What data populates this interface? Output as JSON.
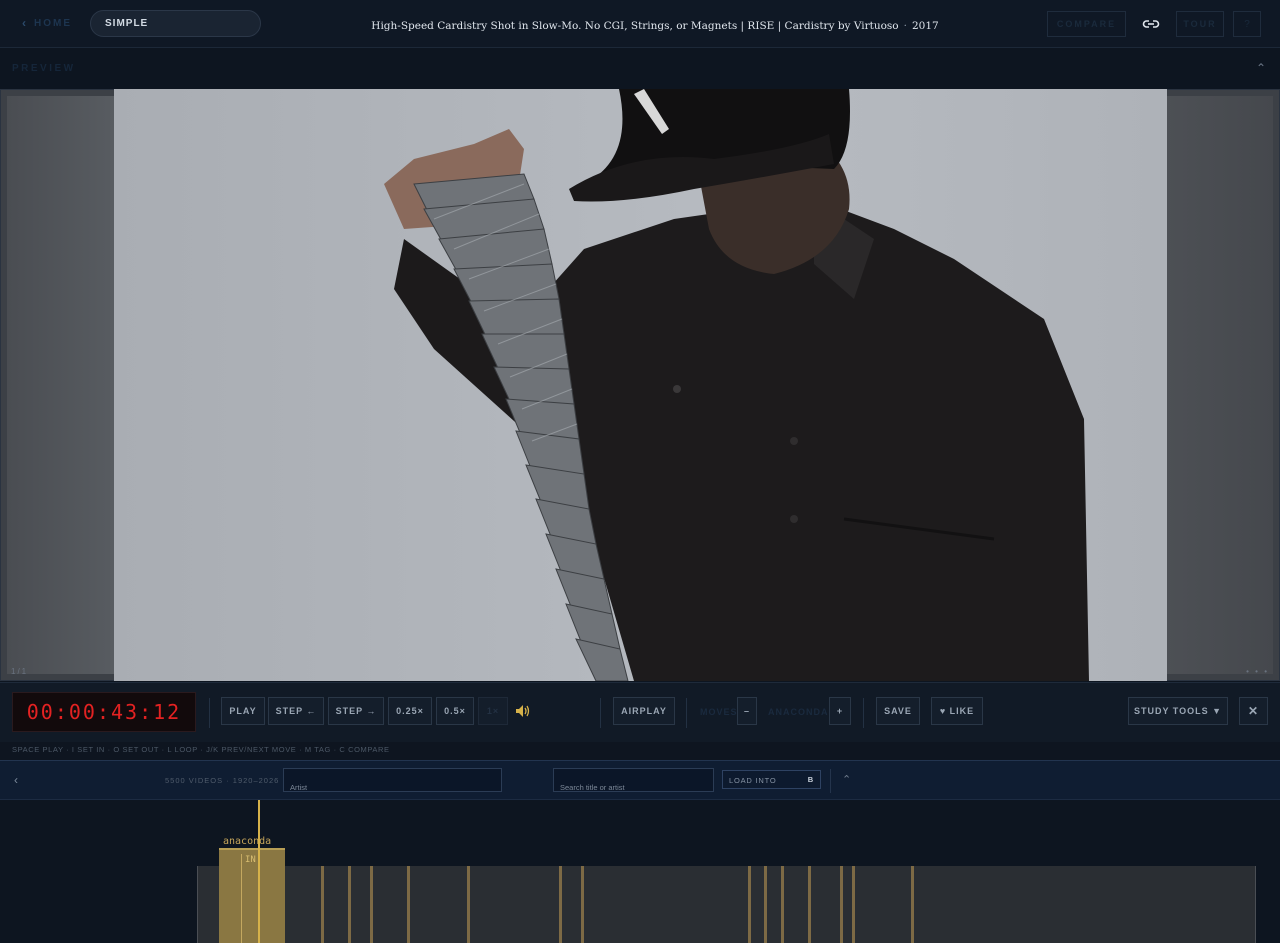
{
  "topbar": {
    "home_label": "HOME",
    "mode": "SIMPLE",
    "video_title": "High-Speed Cardistry Shot in Slow-Mo. No CGI, Strings, or Magnets | RISE | Cardistry by Virtuoso",
    "video_year": "2017",
    "compare_label": "COMPARE",
    "tour_label": "TOUR",
    "help_label": "?"
  },
  "preview": {
    "label": "PREVIEW",
    "corner_left": "1/1",
    "corner_right": "• • •"
  },
  "controls": {
    "timecode": "00:00:43:12",
    "play": "PLAY",
    "step_back": "STEP ←",
    "step_fwd": "STEP →",
    "speed_quarter": "0.25×",
    "speed_half": "0.5×",
    "speed_normal": "1×",
    "airplay": "AIRPLAY",
    "moves_label": "MOVES",
    "moves_value": "–",
    "anacondas_label": "ANACONDAS",
    "anacondas_value": "+",
    "save": "SAVE",
    "like": "♥ LIKE",
    "study_tools": "STUDY TOOLS ▼",
    "close": "✕"
  },
  "shortcuts": "SPACE PLAY · I SET IN · O SET OUT · L LOOP · J/K PREV/NEXT MOVE · M TAG · C COMPARE",
  "library": {
    "count": "5500 VIDEOS · 1920–2026",
    "artist_placeholder": "Artist",
    "search_placeholder": "Search title or artist",
    "load_into_label": "LOAD INTO",
    "load_into_slot": "B"
  },
  "timeline": {
    "tag_label": "anaconda",
    "in_label": "IN"
  },
  "colors": {
    "timecode": "#e32222",
    "accent_gold": "#d6b24a",
    "tag_fill": "#8a7742",
    "background": "#0d1520"
  }
}
